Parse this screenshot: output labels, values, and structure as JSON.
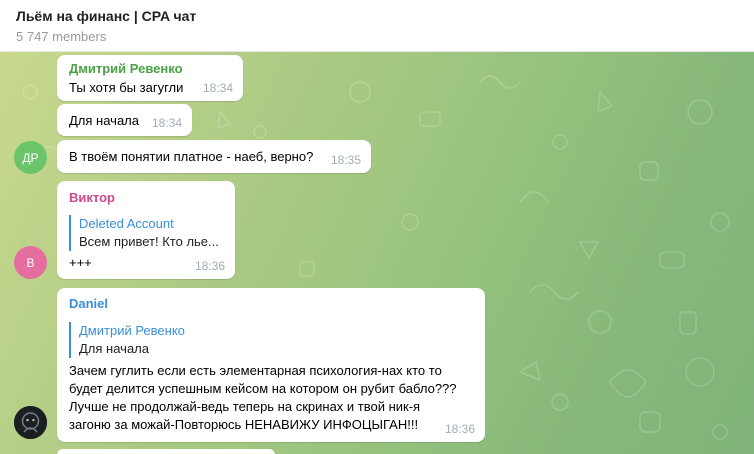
{
  "header": {
    "title": "Льём на финанс | CPA чат",
    "members": "5 747 members"
  },
  "colors": {
    "dmitry_name": "#4aa244",
    "viktor_name": "#d1488a",
    "daniel_name": "#3a8fd8",
    "reply_accent": "#3a8fd8",
    "avatar_dr": "#6cc46a",
    "avatar_v": "#e56da0"
  },
  "messages": [
    {
      "sender": "Дмитрий Ревенко",
      "text": "Ты хотя бы загугли",
      "time": "18:34"
    },
    {
      "text": "Для начала",
      "time": "18:34"
    },
    {
      "avatar": "ДР",
      "icon": "avatar-dr-icon",
      "text": "В твоём понятии платное - наеб, верно?",
      "time": "18:35"
    },
    {
      "sender": "Виктор",
      "reply": {
        "name": "Deleted Account",
        "text": "Всем привет!  Кто лье..."
      },
      "text": "+++",
      "time": "18:36",
      "avatar": "В",
      "icon": "avatar-v-icon"
    },
    {
      "sender": "Daniel",
      "reply": {
        "name": "Дмитрий Ревенко",
        "text": "Для начала"
      },
      "lines": [
        "Зачем гуглить если есть элементарная психология-нах кто то",
        "будет делится успешным кейсом на котором он рубит бабло???",
        "Лучше не продолжай-ведь теперь на скринах и твой ник-я",
        "загоню за можай-Повторюсь НЕНАВИЖУ ИНФОЦЫГАН!!!"
      ],
      "time": "18:36",
      "icon": "avatar-dark-icon"
    }
  ]
}
